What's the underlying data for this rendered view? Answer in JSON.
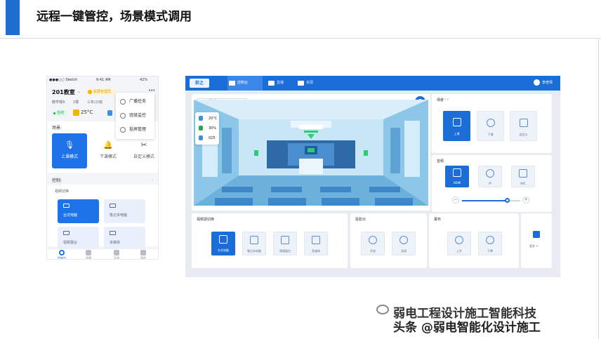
{
  "slide": {
    "title": "远程一键管控，场景模式调用"
  },
  "phone": {
    "status": {
      "carrier": "●●●○○ Sketch",
      "time": "9:41 AM",
      "battery": "42%"
    },
    "room": "201教室",
    "badge": "投屏管理员",
    "more": "•••",
    "sub": [
      "教学楼A",
      "2楼",
      "三年(2)班"
    ],
    "online": "在线",
    "temperature": "25°C",
    "scene_label": "场景:",
    "modes": [
      {
        "label": "上课模式",
        "icon": "microphone-icon"
      },
      {
        "label": "下课模式",
        "icon": "bell-icon"
      },
      {
        "label": "自定义模式",
        "icon": "tools-icon"
      }
    ],
    "control_label": "控制:",
    "arrow": "›",
    "video_switch": "视频切换",
    "sources": [
      {
        "label": "台式电脑",
        "icon": "desktop-icon"
      },
      {
        "label": "笔记本电脑",
        "icon": "laptop-icon"
      },
      {
        "label": "视频展台",
        "icon": "visualizer-icon"
      },
      {
        "label": "多媒体",
        "icon": "media-icon"
      }
    ],
    "tabs": [
      "控制台",
      "直播",
      "资源",
      "我的"
    ],
    "dropdown": [
      "广播任务",
      "班级监控",
      "投屏管理"
    ]
  },
  "desk": {
    "logo": "彩之",
    "nav": [
      "控制台",
      "直播",
      "资源"
    ],
    "user": "李老师",
    "room": "101教室",
    "meta": [
      "教学楼A",
      "2楼",
      "三年(2)班",
      "在线"
    ],
    "sensor": [
      "20°C",
      "30%",
      "025"
    ],
    "scene": {
      "title": "场景",
      "nav": "‹  ›",
      "tiles": [
        {
          "label": "上课",
          "icon": "person-icon"
        },
        {
          "label": "下课",
          "icon": "clock-icon"
        },
        {
          "label": "自定义",
          "icon": "tools-icon"
        }
      ]
    },
    "audio": {
      "title": "音频",
      "tiles": [
        {
          "label": "HDMI",
          "icon": "hdmi-icon"
        },
        {
          "label": "IP",
          "icon": "globe-icon"
        },
        {
          "label": "MIC",
          "icon": "microphone-icon"
        }
      ],
      "minus": "−",
      "plus": "+",
      "volume": 0.78
    },
    "video": {
      "title": "视频源切换",
      "tiles": [
        {
          "label": "台式电脑",
          "icon": "desktop-icon"
        },
        {
          "label": "笔记本电脑",
          "icon": "laptop-icon"
        },
        {
          "label": "视频展台",
          "icon": "visualizer-icon"
        },
        {
          "label": "多媒体",
          "icon": "media-icon"
        }
      ]
    },
    "projector": {
      "title": "投影仪",
      "tiles": [
        {
          "label": "开启",
          "icon": "power-on-icon"
        },
        {
          "label": "关闭",
          "icon": "power-off-icon"
        }
      ]
    },
    "screen": {
      "title": "幕布",
      "tiles": [
        {
          "label": "上升",
          "icon": "arrow-up-icon"
        },
        {
          "label": "下降",
          "icon": "arrow-down-icon"
        }
      ]
    },
    "more": "更多 >"
  },
  "watermark": {
    "line1": "弱电工程设计施工智能科技",
    "line2": "头条 @弱电智能化设计施工"
  },
  "colors": {
    "accent": "#1b6ed8",
    "header_bar": "#1e6fd0"
  }
}
